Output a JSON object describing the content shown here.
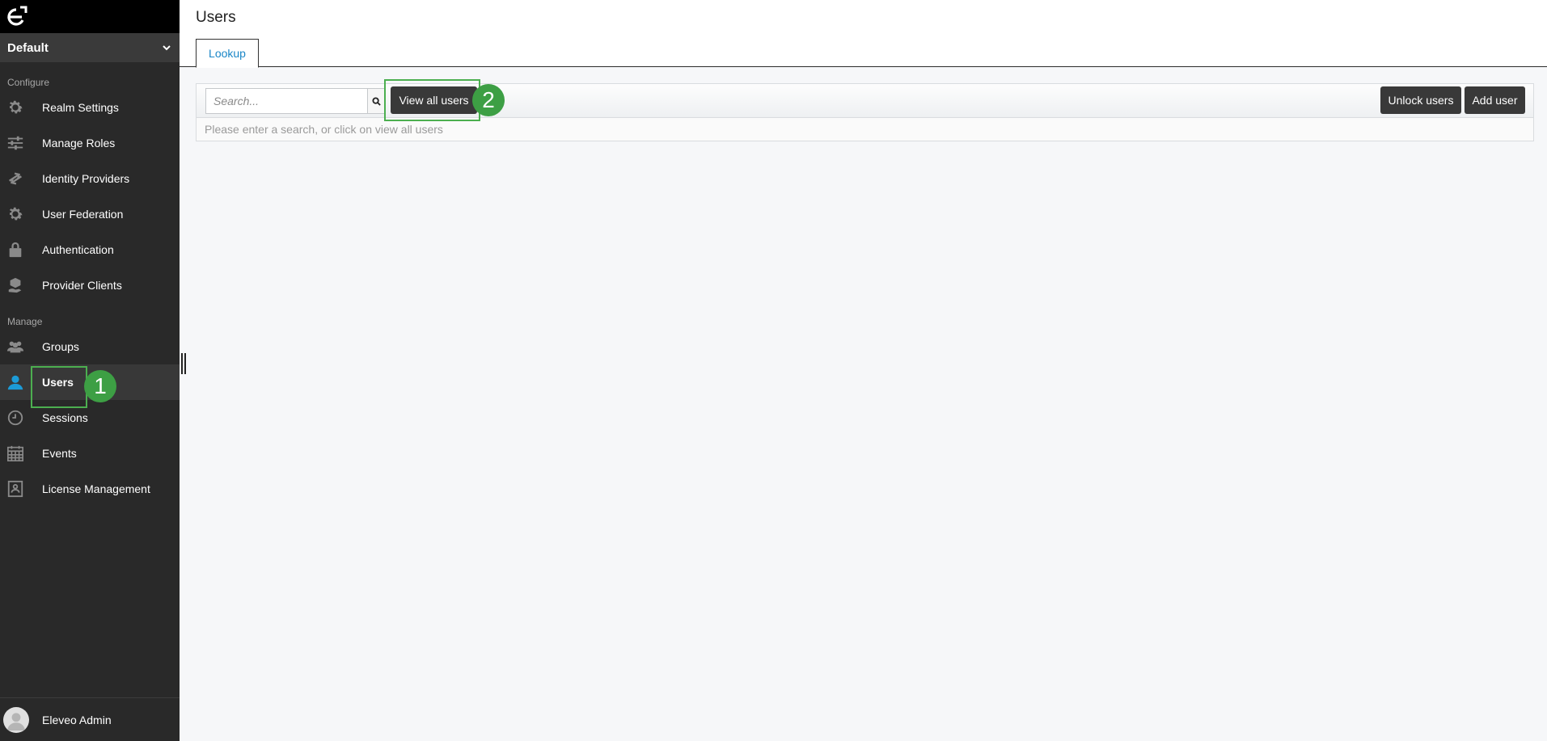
{
  "sidebar": {
    "realm": "Default",
    "sections": {
      "configure": "Configure",
      "manage": "Manage"
    },
    "configure_items": [
      {
        "label": "Realm Settings",
        "icon": "gear-icon"
      },
      {
        "label": "Manage Roles",
        "icon": "sliders-icon"
      },
      {
        "label": "Identity Providers",
        "icon": "exchange-icon"
      },
      {
        "label": "User Federation",
        "icon": "gear-icon"
      },
      {
        "label": "Authentication",
        "icon": "lock-icon"
      },
      {
        "label": "Provider Clients",
        "icon": "cube-hand-icon"
      }
    ],
    "manage_items": [
      {
        "label": "Groups",
        "icon": "users-group-icon"
      },
      {
        "label": "Users",
        "icon": "user-icon",
        "active": true
      },
      {
        "label": "Sessions",
        "icon": "clock-icon"
      },
      {
        "label": "Events",
        "icon": "calendar-icon"
      },
      {
        "label": "License Management",
        "icon": "license-icon"
      }
    ],
    "footer_user": "Eleveo Admin"
  },
  "annotations": {
    "step1": "1",
    "step2": "2"
  },
  "header": {
    "title": "Users",
    "tabs": [
      {
        "label": "Lookup",
        "active": true
      }
    ]
  },
  "toolbar": {
    "search_placeholder": "Search...",
    "view_all_label": "View all users",
    "unlock_label": "Unlock users",
    "add_label": "Add user",
    "hint": "Please enter a search, or click on view all users"
  },
  "colors": {
    "accent": "#1c9bd7",
    "highlight": "#4caf50",
    "sidebar_bg": "#292929"
  }
}
